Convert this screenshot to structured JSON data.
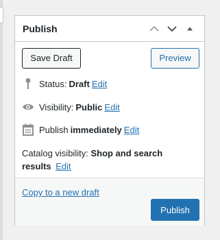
{
  "panel": {
    "title": "Publish",
    "icons": [
      "chevron-up-icon",
      "chevron-down-icon",
      "triangle-up-icon"
    ]
  },
  "buttons": {
    "save_draft": "Save Draft",
    "preview": "Preview",
    "publish": "Publish"
  },
  "status": {
    "label": "Status:",
    "value": "Draft",
    "edit": "Edit"
  },
  "visibility": {
    "label": "Visibility:",
    "value": "Public",
    "edit": "Edit"
  },
  "schedule": {
    "label": "Publish",
    "value": "immediately",
    "edit": "Edit"
  },
  "catalog": {
    "label": "Catalog visibility:",
    "value": "Shop and search results",
    "edit": "Edit"
  },
  "footer": {
    "copy_link": "Copy to a new draft"
  },
  "colors": {
    "accent": "#2271b1",
    "text": "#1d2327",
    "border": "#c3c4c7"
  }
}
